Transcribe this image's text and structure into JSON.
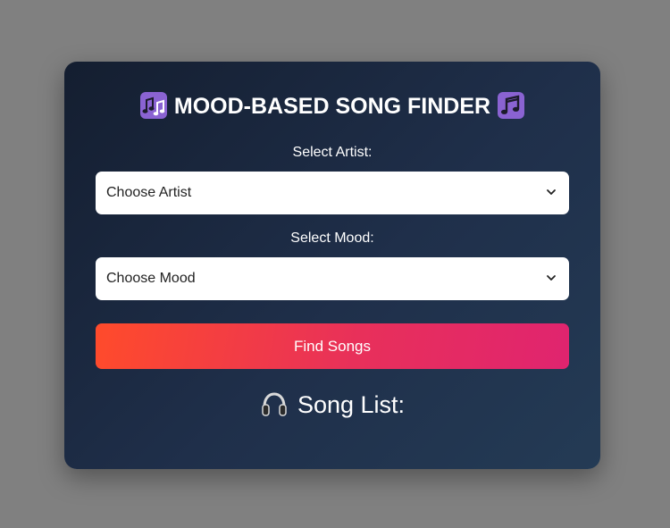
{
  "header": {
    "title": "MOOD-BASED SONG FINDER",
    "left_icon": "musical-notes-icon",
    "right_icon": "musical-note-icon"
  },
  "artist": {
    "label": "Select Artist:",
    "selected": "Choose Artist"
  },
  "mood": {
    "label": "Select Mood:",
    "selected": "Choose Mood"
  },
  "actions": {
    "find_label": "Find Songs"
  },
  "results": {
    "heading": "Song List:",
    "icon": "headphones-icon"
  },
  "colors": {
    "page_background": "#808080",
    "card_gradient_start": "#141e30",
    "card_gradient_end": "#243b55",
    "button_gradient_start": "#ff4b2b",
    "button_gradient_end": "#e0246f",
    "emoji_purple": "#8a63d2"
  }
}
